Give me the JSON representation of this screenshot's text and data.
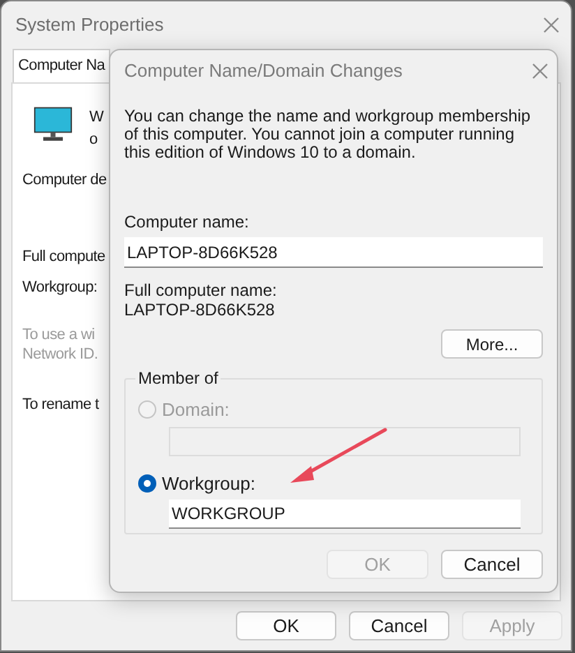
{
  "window": {
    "title": "System Properties"
  },
  "tabs": [
    {
      "label": "Computer Na",
      "selected": true
    }
  ],
  "panel": {
    "heading_lines": [
      "W",
      "o"
    ],
    "items": [
      {
        "text": "Computer de",
        "kind": "label"
      },
      {
        "text": "Full compute",
        "kind": "label"
      },
      {
        "text": "Workgroup:",
        "kind": "label"
      },
      {
        "text": "To use a wi",
        "kind": "hint"
      },
      {
        "text": "Network ID.",
        "kind": "hint"
      },
      {
        "text": "To rename t",
        "kind": "label"
      }
    ]
  },
  "buttons": [
    {
      "label": "OK",
      "disabled": false
    },
    {
      "label": "Cancel",
      "disabled": false
    },
    {
      "label": "Apply",
      "disabled": true
    }
  ],
  "dialog": {
    "title": "Computer Name/Domain Changes",
    "description": "You can change the name and workgroup membership of this computer. You cannot join a computer running this edition of Windows 10 to a domain.",
    "computer_name": {
      "label": "Computer name:",
      "value": "LAPTOP-8D66K528"
    },
    "full_computer_name": {
      "label": "Full computer name:",
      "value": "LAPTOP-8D66K528"
    },
    "more_button": "More...",
    "member_of": {
      "legend": "Member of",
      "options": [
        {
          "label": "Domain:",
          "selected": false,
          "disabled": true
        },
        {
          "label": "Workgroup:",
          "selected": true,
          "disabled": false,
          "value": "WORKGROUP"
        }
      ]
    },
    "buttons": [
      {
        "label": "OK",
        "disabled": true
      },
      {
        "label": "Cancel",
        "disabled": false
      }
    ]
  }
}
